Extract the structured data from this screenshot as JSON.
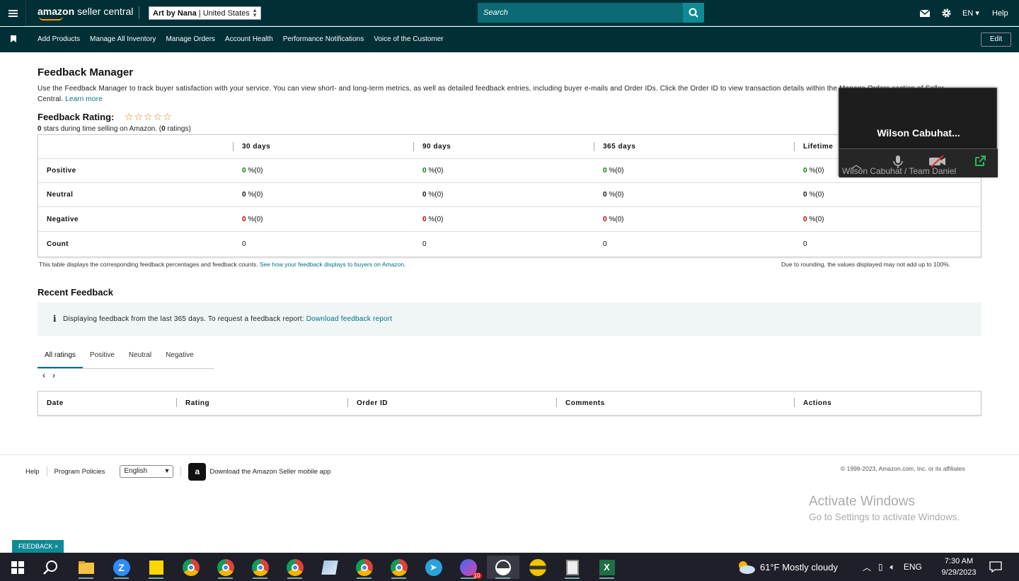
{
  "header": {
    "logo": {
      "brand": "amazon",
      "suffix": "seller central"
    },
    "store": {
      "name": "Art by Nana",
      "region": "United States"
    },
    "search_placeholder": "Search",
    "lang": "EN",
    "help": "Help",
    "icons": [
      "menu-icon",
      "mail-icon",
      "gear-icon",
      "search-icon"
    ]
  },
  "nav": {
    "items": [
      "Add Products",
      "Manage All Inventory",
      "Manage Orders",
      "Account Health",
      "Performance Notifications",
      "Voice of the Customer"
    ],
    "edit": "Edit"
  },
  "page": {
    "title": "Feedback Manager",
    "intro": "Use the Feedback Manager to track buyer satisfaction with your service. You can view short- and long-term metrics, as well as detailed feedback entries, including buyer e-mails and Order IDs. Click the Order ID to view transaction details within the Manage Orders section of Seller Central.",
    "learn_more": "Learn more",
    "rating_title": "Feedback Rating:",
    "stars": "☆☆☆☆☆",
    "rating_sub_stars": "0",
    "rating_sub_mid": " stars during time selling on Amazon. (",
    "rating_sub_count": "0",
    "rating_sub_end": " ratings)"
  },
  "feedback_table": {
    "columns": [
      "30 days",
      "90 days",
      "365 days",
      "Lifetime"
    ],
    "rows": [
      {
        "label": "Positive",
        "values": [
          "0",
          "0",
          "0",
          "0"
        ],
        "suffix": "%(0)"
      },
      {
        "label": "Neutral",
        "values": [
          "0",
          "0",
          "0",
          "0"
        ],
        "suffix": "%(0)"
      },
      {
        "label": "Negative",
        "values": [
          "0",
          "0",
          "0",
          "0"
        ],
        "suffix": "%(0)"
      },
      {
        "label": "Count",
        "values": [
          "0",
          "0",
          "0",
          "0"
        ],
        "suffix": ""
      }
    ],
    "note_left": "This table displays the corresponding feedback percentages and feedback counts.",
    "note_link": "See how your feedback displays to buyers on Amazon.",
    "note_right": "Due to rounding, the values displayed may not add up to 100%."
  },
  "recent": {
    "title": "Recent Feedback",
    "info_icon": "i",
    "info_text": "Displaying feedback from the last 365 days. To request a feedback report:",
    "info_link": "Download feedback report",
    "tabs": [
      "All ratings",
      "Positive",
      "Neutral",
      "Negative"
    ],
    "pager_prev": "‹",
    "pager_next": "›",
    "columns": [
      "Date",
      "Rating",
      "Order ID",
      "Comments",
      "Actions"
    ]
  },
  "footer": {
    "help": "Help",
    "policies": "Program Policies",
    "language": "English",
    "app_text": "Download the Amazon Seller mobile app",
    "copyright": "© 1999-2023, Amazon.com, Inc. or its affiliates"
  },
  "activate": {
    "line1": "Activate Windows",
    "line2": "Go to Settings to activate Windows."
  },
  "feedback_tab": "FEEDBACK ×",
  "zoom_overlay": {
    "name": "Wilson  Cabuhat...",
    "subtitle": "Wilson Cabuhat / Team Daniel"
  },
  "taskbar": {
    "weather": "61°F  Mostly cloudy",
    "lang": "ENG",
    "time": "7:30 AM",
    "date": "9/29/2023",
    "badge": "10"
  }
}
